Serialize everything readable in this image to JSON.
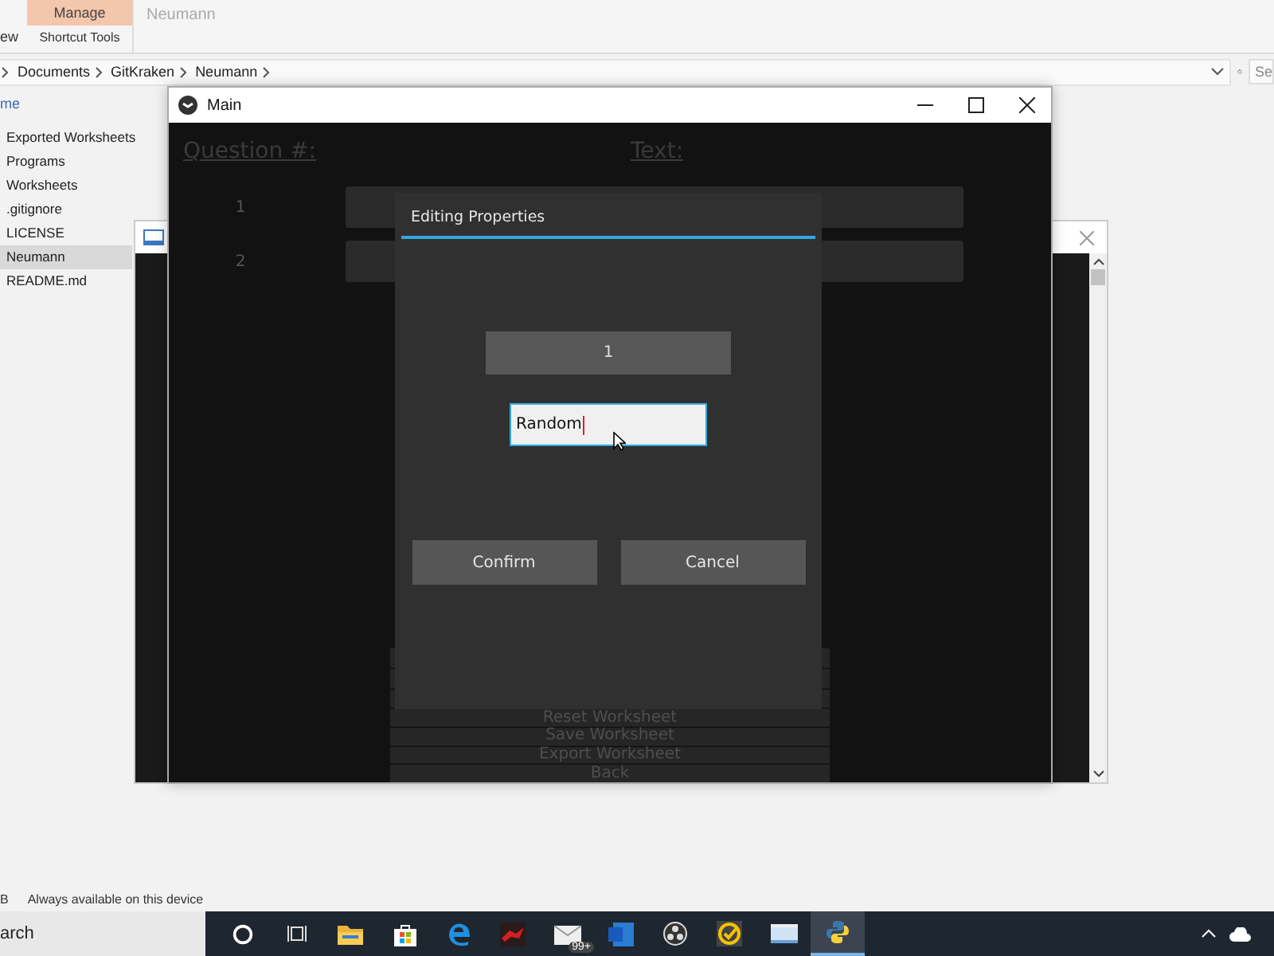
{
  "explorer": {
    "ribbon_tabs": [
      {
        "label": "Manage",
        "selected": true
      }
    ],
    "ribbon_cut_label": "ew",
    "ribbon_group": "Shortcut Tools",
    "title": "Neumann",
    "breadcrumb": [
      "Documents",
      "GitKraken",
      "Neumann"
    ],
    "search_placeholder": "Se",
    "sidebar_header": "me",
    "sidebar_items": [
      {
        "label": "Exported Worksheets",
        "selected": false
      },
      {
        "label": "Programs",
        "selected": false
      },
      {
        "label": "Worksheets",
        "selected": false
      },
      {
        "label": ".gitignore",
        "selected": false
      },
      {
        "label": "LICENSE",
        "selected": false
      },
      {
        "label": "Neumann",
        "selected": true
      },
      {
        "label": "README.md",
        "selected": false
      }
    ],
    "status_bar": [
      "B",
      "Always available on this device"
    ]
  },
  "main_window": {
    "title": "Main",
    "headers": [
      "Question #:",
      "Text:"
    ],
    "questions": [
      {
        "number": "1"
      },
      {
        "number": "2"
      }
    ],
    "menu_buttons": [
      "Reset Worksheet",
      "Save Worksheet",
      "Export Worksheet",
      "Back"
    ]
  },
  "dialog": {
    "title": "Editing Properties",
    "number_button": "1",
    "input_value": "Random",
    "buttons": [
      "Confirm",
      "Cancel"
    ]
  },
  "taskbar": {
    "search": "arch",
    "apps": [
      {
        "kind": "cortana",
        "selected": false
      },
      {
        "kind": "taskview",
        "selected": false
      },
      {
        "kind": "folder",
        "selected": false
      },
      {
        "kind": "store",
        "selected": false
      },
      {
        "kind": "edge",
        "selected": false
      },
      {
        "kind": "red",
        "selected": false
      },
      {
        "kind": "mail",
        "selected": false,
        "badge": "99+"
      },
      {
        "kind": "word",
        "selected": false
      },
      {
        "kind": "obs",
        "selected": false
      },
      {
        "kind": "check",
        "selected": false
      },
      {
        "kind": "window",
        "selected": false
      },
      {
        "kind": "python",
        "selected": true
      }
    ]
  }
}
